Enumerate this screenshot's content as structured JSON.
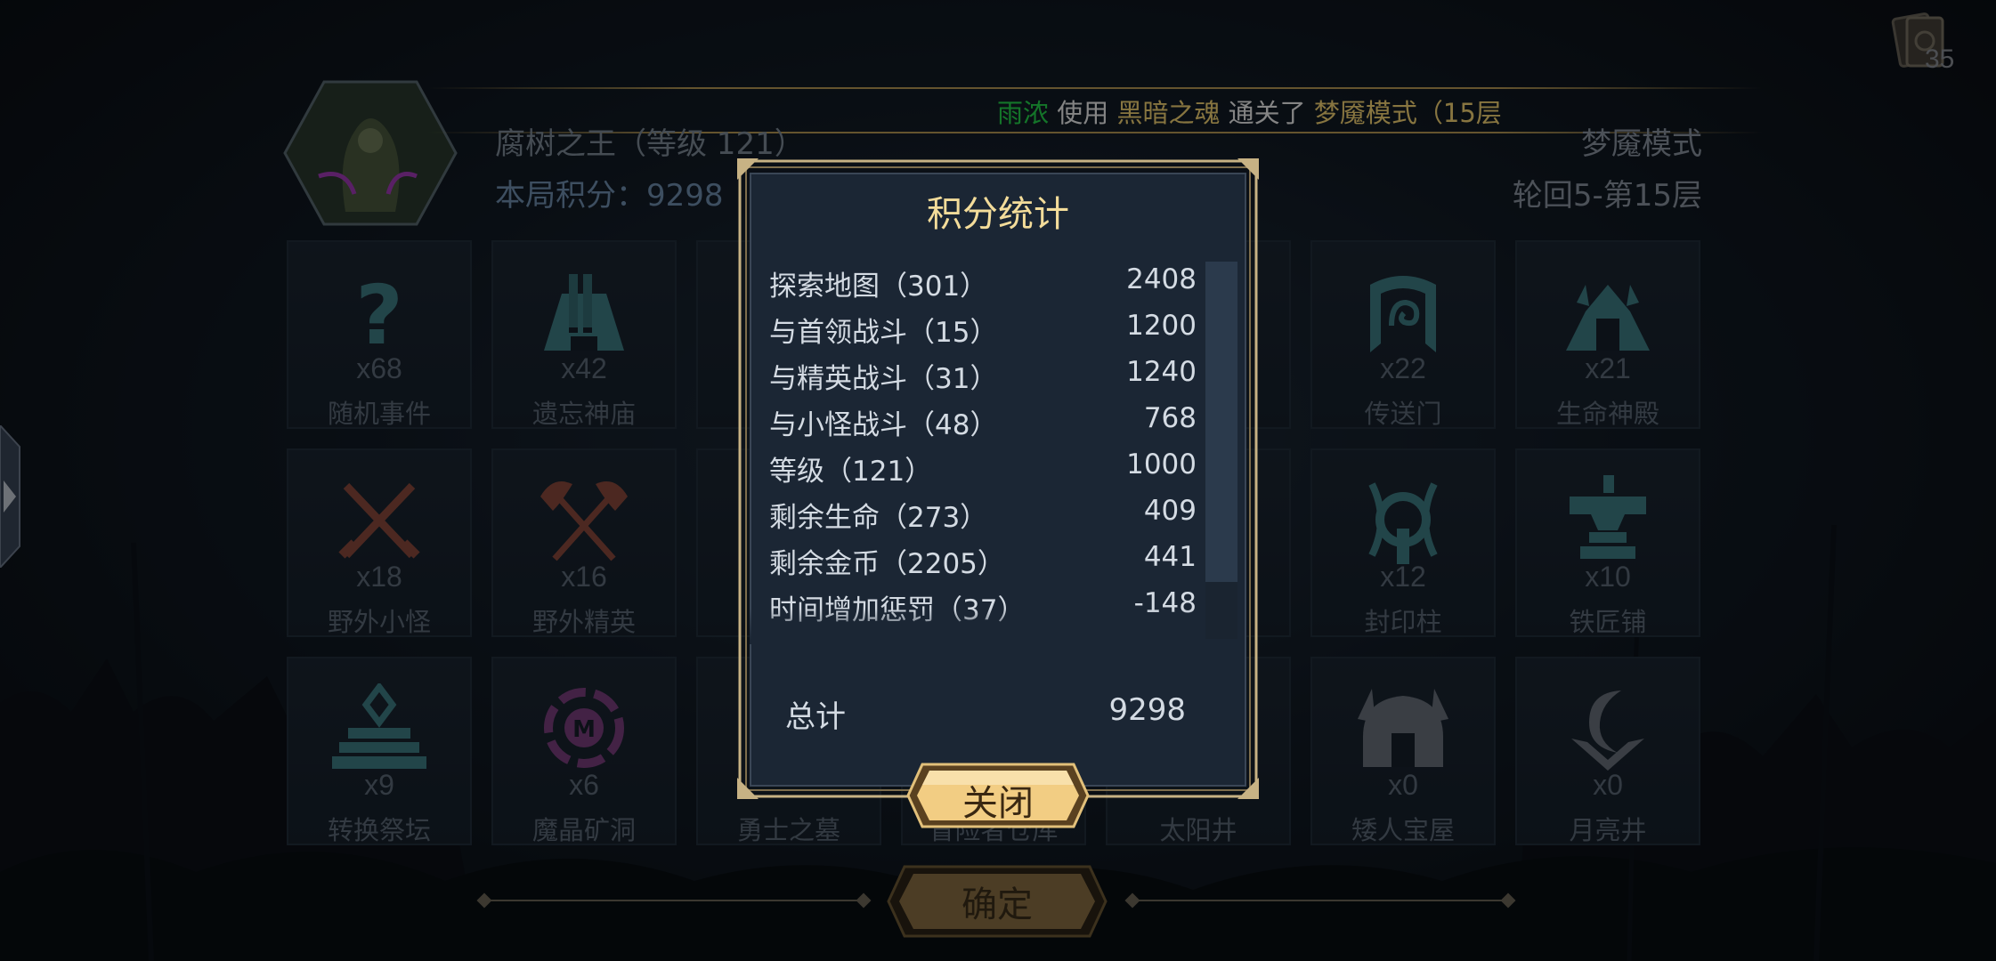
{
  "header": {
    "broadcast": {
      "player": "雨浓",
      "verb": " 使用 ",
      "item": "黑暗之魂",
      "mid": " 通关了 ",
      "mode": "梦魇模式（15层"
    },
    "boss_name": "腐树之王（等级 121）",
    "round_score": "本局积分：9298",
    "mode_name": "梦魇模式",
    "floor_text": "轮回5-第15层",
    "deck_count": "35"
  },
  "tiles": [
    {
      "count": "x68",
      "label": "随机事件",
      "icon": "question-icon",
      "color": "#3f7f86"
    },
    {
      "count": "x42",
      "label": "遗忘神庙",
      "icon": "temple-icon",
      "color": "#3f7f86"
    },
    {
      "count": "",
      "label": "",
      "icon": "hidden",
      "color": "#3f7f86"
    },
    {
      "count": "",
      "label": "",
      "icon": "hidden",
      "color": "#3f7f86"
    },
    {
      "count": "",
      "label": "",
      "icon": "hidden",
      "color": "#3f7f86"
    },
    {
      "count": "x22",
      "label": "传送门",
      "icon": "portal-icon",
      "color": "#3f7f86"
    },
    {
      "count": "x21",
      "label": "生命神殿",
      "icon": "life-shrine-icon",
      "color": "#3f7f86"
    },
    {
      "count": "x18",
      "label": "野外小怪",
      "icon": "crossed-swords-icon",
      "color": "#8a4a3c"
    },
    {
      "count": "x16",
      "label": "野外精英",
      "icon": "crossed-axes-icon",
      "color": "#8a4a3c"
    },
    {
      "count": "",
      "label": "",
      "icon": "hidden",
      "color": "#3f7f86"
    },
    {
      "count": "",
      "label": "",
      "icon": "hidden",
      "color": "#3f7f86"
    },
    {
      "count": "",
      "label": "",
      "icon": "hidden",
      "color": "#3f7f86"
    },
    {
      "count": "x12",
      "label": "封印柱",
      "icon": "seal-pillar-icon",
      "color": "#3f7f86"
    },
    {
      "count": "x10",
      "label": "铁匠铺",
      "icon": "anvil-icon",
      "color": "#3f7f86"
    },
    {
      "count": "x9",
      "label": "转换祭坛",
      "icon": "altar-icon",
      "color": "#3f7f86"
    },
    {
      "count": "x6",
      "label": "魔晶矿洞",
      "icon": "crystal-mine-icon",
      "color": "#7a3f7e"
    },
    {
      "count": "",
      "label": "勇士之墓",
      "icon": "tomb-icon",
      "color": "#3f4a56"
    },
    {
      "count": "",
      "label": "冒险者仓库",
      "icon": "warehouse-icon",
      "color": "#3f4a56"
    },
    {
      "count": "",
      "label": "太阳井",
      "icon": "sun-well-icon",
      "color": "#3f4a56"
    },
    {
      "count": "x0",
      "label": "矮人宝屋",
      "icon": "dwarf-treasure-icon",
      "color": "#6a727c"
    },
    {
      "count": "x0",
      "label": "月亮井",
      "icon": "moon-well-icon",
      "color": "#6a727c"
    }
  ],
  "dialog": {
    "title": "积分统计",
    "rows": [
      {
        "name": "探索地图（301）",
        "value": "2408"
      },
      {
        "name": "与首领战斗（15）",
        "value": "1200"
      },
      {
        "name": "与精英战斗（31）",
        "value": "1240"
      },
      {
        "name": "与小怪战斗（48）",
        "value": "768"
      },
      {
        "name": "等级（121）",
        "value": "1000"
      },
      {
        "name": "剩余生命（273）",
        "value": "409"
      },
      {
        "name": "剩余金币（2205）",
        "value": "441"
      },
      {
        "name": "时间增加惩罚（37）",
        "value": "-148"
      },
      {
        "name": "…",
        "value": "…"
      }
    ],
    "total_label": "总计",
    "total_value": "9298",
    "close_label": "关闭"
  },
  "footer": {
    "confirm_label": "确定"
  }
}
